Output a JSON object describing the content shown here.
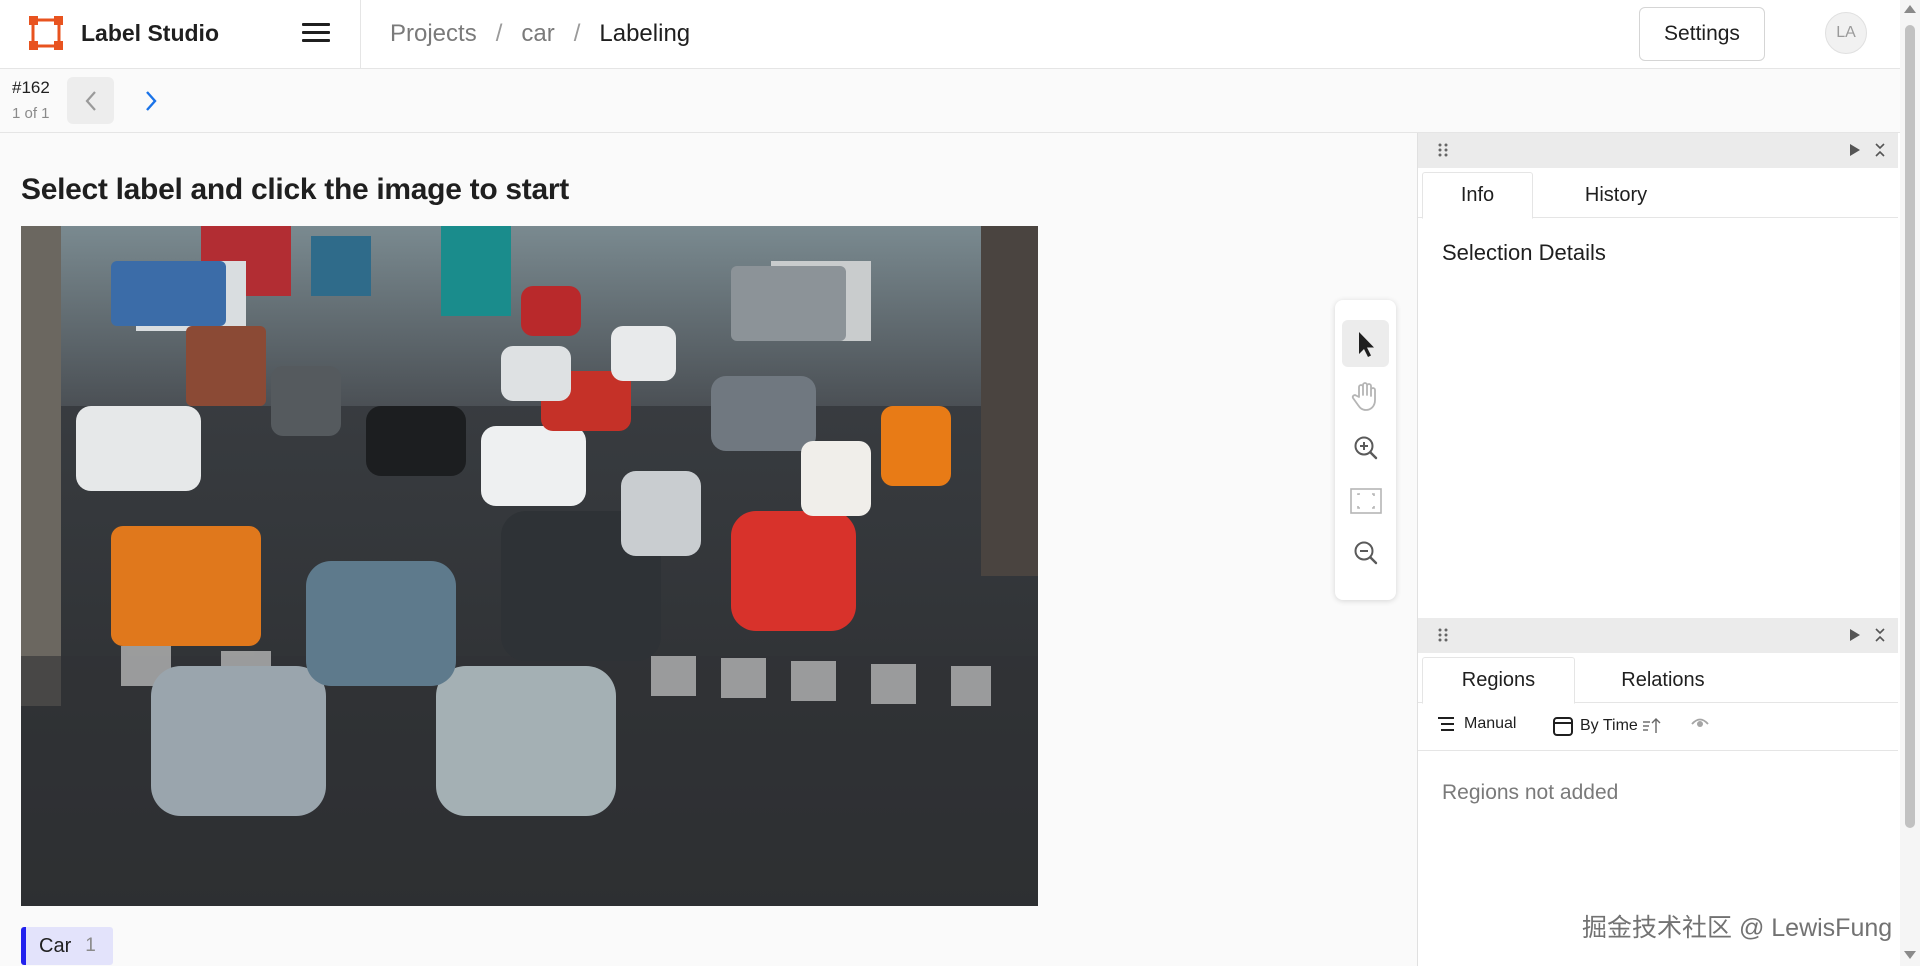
{
  "app": {
    "name": "Label Studio",
    "brand_color": "#e8531f"
  },
  "header": {
    "breadcrumb": [
      "Projects",
      "car",
      "Labeling"
    ],
    "breadcrumb_separator": "/",
    "settings_label": "Settings",
    "avatar_initials": "LA"
  },
  "task": {
    "id": "#162",
    "position": "1 of 1"
  },
  "main": {
    "instruction": "Select label and click the image to start",
    "image_icon": "street-traffic-photo",
    "label": {
      "name": "Car",
      "count": "1",
      "color": "#2222ee"
    },
    "tools": [
      {
        "name": "select-tool",
        "icon": "cursor-arrow-icon",
        "active": true
      },
      {
        "name": "pan-tool",
        "icon": "hand-icon",
        "active": false
      },
      {
        "name": "zoom-in-tool",
        "icon": "zoom-in-icon",
        "active": false
      },
      {
        "name": "fit-tool",
        "icon": "fit-frame-icon",
        "active": false
      },
      {
        "name": "zoom-out-tool",
        "icon": "zoom-out-icon",
        "active": false
      }
    ]
  },
  "info_panel": {
    "tabs": [
      "Info",
      "History"
    ],
    "active_tab": "Info",
    "section_title": "Selection Details"
  },
  "regions_panel": {
    "tabs": [
      "Regions",
      "Relations"
    ],
    "active_tab": "Regions",
    "filters": {
      "grouping": "Manual",
      "sort": "By Time"
    },
    "empty_message": "Regions not added"
  },
  "watermark": "掘金技术社区 @ LewisFung"
}
